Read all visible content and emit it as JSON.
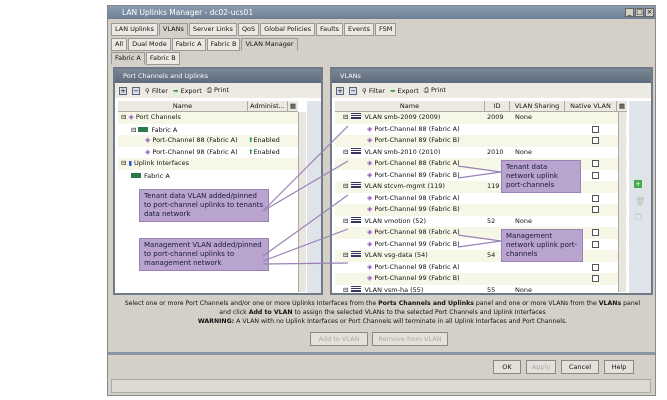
{
  "window": {
    "title": "LAN Uplinks Manager - dc02-ucs01"
  },
  "tabs1": [
    "LAN Uplinks",
    "VLANs",
    "Server Links",
    "QoS",
    "Global Policies",
    "Faults",
    "Events",
    "FSM"
  ],
  "tabs2": [
    "All",
    "Dual Mode",
    "Fabric A",
    "Fabric B",
    "VLAN Manager"
  ],
  "tabs3": [
    "Fabric A",
    "Fabric B"
  ],
  "left": {
    "title": "Port Channels and Uplinks",
    "toolbar": {
      "filter": "Filter",
      "export": "Export",
      "print": "Print"
    },
    "columns": [
      "Name",
      "Administ..."
    ],
    "rows": [
      {
        "name": "Port Channels",
        "status": ""
      },
      {
        "name": "Fabric A",
        "status": ""
      },
      {
        "name": "Port-Channel 88 (Fabric A)",
        "status": "Enabled"
      },
      {
        "name": "Port-Channel 98 (Fabric A)",
        "status": "Enabled"
      },
      {
        "name": "Uplink Interfaces",
        "status": ""
      },
      {
        "name": "Fabric A",
        "status": ""
      }
    ]
  },
  "right": {
    "title": "VLANs",
    "toolbar": {
      "filter": "Filter",
      "export": "Export",
      "print": "Print"
    },
    "columns": [
      "Name",
      "ID",
      "VLAN Sharing",
      "Native VLAN"
    ],
    "rows": [
      {
        "name": "VLAN smb-2009 (2009)",
        "id": "2009",
        "sharing": "None"
      },
      {
        "name": "Port-Channel 88 (Fabric A)"
      },
      {
        "name": "Port-Channel 89 (Fabric B)"
      },
      {
        "name": "VLAN smb-2010 (2010)",
        "id": "2010",
        "sharing": "None"
      },
      {
        "name": "Port-Channel 88 (Fabric A)"
      },
      {
        "name": "Port-Channel 89 (Fabric B)"
      },
      {
        "name": "VLAN stcvm-mgmt (119)",
        "id": "119",
        "sharing": "None"
      },
      {
        "name": "Port-Channel 98 (Fabric A)"
      },
      {
        "name": "Port-Channel 99 (Fabric B)"
      },
      {
        "name": "VLAN vmotion (52)",
        "id": "52",
        "sharing": "None"
      },
      {
        "name": "Port-Channel 98 (Fabric A)"
      },
      {
        "name": "Port-Channel 99 (Fabric B)"
      },
      {
        "name": "VLAN vsg-data (54)",
        "id": "54",
        "sharing": "None"
      },
      {
        "name": "Port-Channel 98 (Fabric A)"
      },
      {
        "name": "Port-Channel 99 (Fabric B)"
      },
      {
        "name": "VLAN vsm-ha (55)",
        "id": "55",
        "sharing": "None"
      }
    ]
  },
  "callouts": {
    "tenant_left": "Tenant data VLAN added/pinned to port-channel uplinks to tenants data network",
    "mgmt_left": "Management VLAN added/pinned to port-channel uplinks to management network",
    "tenant_right": "Tenant data network uplink port-channels",
    "mgmt_right": "Management network uplink port-channels"
  },
  "instructions": {
    "line1_a": "Select one or more Port Channels and/or one or more Uplinks Interfaces from the ",
    "line1_b": "Ports Channels and Uplinks",
    "line1_c": " panel and one or more VLANs from the ",
    "line1_d": "VLANs",
    "line1_e": " panel",
    "line2_a": "and click ",
    "line2_b": "Add to VLAN",
    "line2_c": " to assign the selected VLANs to the selected Port Channels and Uplink Interfaces",
    "line3_a": "WARNING:",
    "line3_b": " A VLAN with no Uplink Interfaces or Port Channels will terminate in all Uplink Interfaces and Port Channels."
  },
  "buttons": {
    "add": "Add to VLAN",
    "remove": "Remove from VLAN",
    "ok": "OK",
    "apply": "Apply",
    "cancel": "Cancel",
    "help": "Help"
  }
}
